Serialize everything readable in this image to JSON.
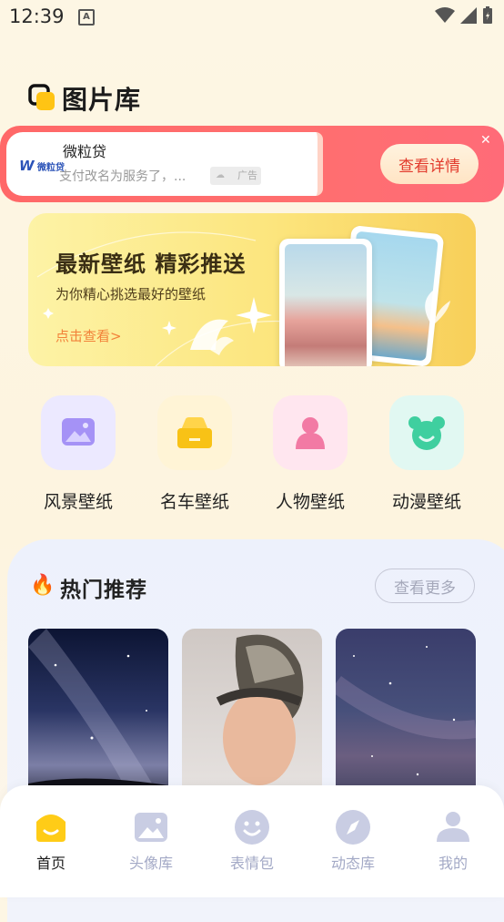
{
  "status": {
    "time": "12:39"
  },
  "header": {
    "title": "图片库"
  },
  "ad": {
    "brand": "微粒贷",
    "advertiser": "微粒贷",
    "text": "支付改名为服务了，...",
    "tag": "广告",
    "button": "查看详情"
  },
  "banner": {
    "title": "最新壁纸 精彩推送",
    "subtitle": "为你精心挑选最好的壁纸",
    "link": "点击查看>"
  },
  "categories": [
    {
      "label": "风景壁纸",
      "icon": "landscape-icon",
      "bg": "#ece9ff",
      "color": "#9d86f3"
    },
    {
      "label": "名车壁纸",
      "icon": "car-icon",
      "bg": "#fff4d6",
      "color": "#f6c116"
    },
    {
      "label": "人物壁纸",
      "icon": "person-icon",
      "bg": "#ffe6ef",
      "color": "#f27aa4"
    },
    {
      "label": "动漫壁纸",
      "icon": "bear-icon",
      "bg": "#e1f8f2",
      "color": "#3fcf9f"
    }
  ],
  "hot": {
    "title": "热门推荐",
    "more": "查看更多"
  },
  "nav": [
    {
      "label": "首页",
      "icon": "home-icon",
      "active": true
    },
    {
      "label": "头像库",
      "icon": "image-icon",
      "active": false
    },
    {
      "label": "表情包",
      "icon": "smile-icon",
      "active": false
    },
    {
      "label": "动态库",
      "icon": "compass-icon",
      "active": false
    },
    {
      "label": "我的",
      "icon": "user-icon",
      "active": false
    }
  ]
}
